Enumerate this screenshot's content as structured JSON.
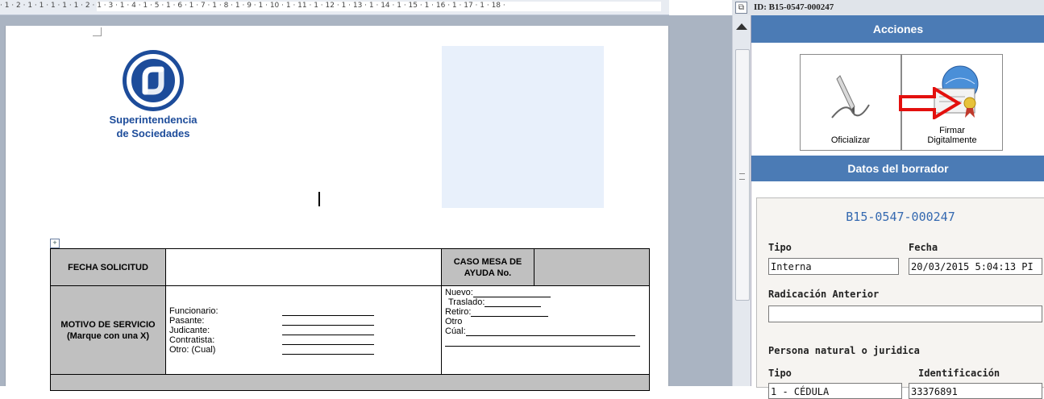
{
  "ruler": {
    "text": "· 1 · 2 · 1 · 1 · 1 · 1 · 1 · 2 · 1 · 3 · 1 · 4 · 1 · 5 · 1 · 6 · 1 · 7 · 1 · 8 · 1 · 9 · 1 · 10 · 1 · 11 · 1 · 12 · 1 · 13 · 1 · 14 · 1 · 15 · 1 · 16 · 1 · 17 · 1 · 18 ·"
  },
  "logo": {
    "line1": "Superintendencia",
    "line2": "de Sociedades",
    "color": "#1d4c9a"
  },
  "form": {
    "fecha_solicitud": "FECHA  SOLICITUD",
    "caso_mesa": "CASO MESA DE AYUDA  No.",
    "motivo": "MOTIVO DE SERVICIO (Marque con una X)",
    "roles": [
      "Funcionario:",
      "Pasante:",
      "Judicante:",
      "Contratista:",
      "Otro: (Cual)"
    ],
    "options": [
      "Nuevo:",
      "Traslado:",
      "Retiro:",
      "Otro",
      "Cúal:"
    ]
  },
  "panel": {
    "id": "ID: B15-0547-000247",
    "acciones": "Acciones",
    "oficializar": "Oficializar",
    "firmar_line1": "Firmar",
    "firmar_line2": "Digitalmente",
    "datos": "Datos del borrador",
    "code": "B15-0547-000247",
    "tipo_label": "Tipo",
    "fecha_label": "Fecha",
    "tipo_value": "Interna",
    "fecha_value": "20/03/2015 5:04:13 PI",
    "radicacion_label": "Radicación Anterior",
    "radicacion_value": "",
    "persona_label": "Persona natural o juridica",
    "tipo2_label": "Tipo",
    "ident_label": "Identificación",
    "tipo2_value": "1 - CÉDULA",
    "ident_value": "33376891",
    "accent": "#4b7bb5"
  }
}
